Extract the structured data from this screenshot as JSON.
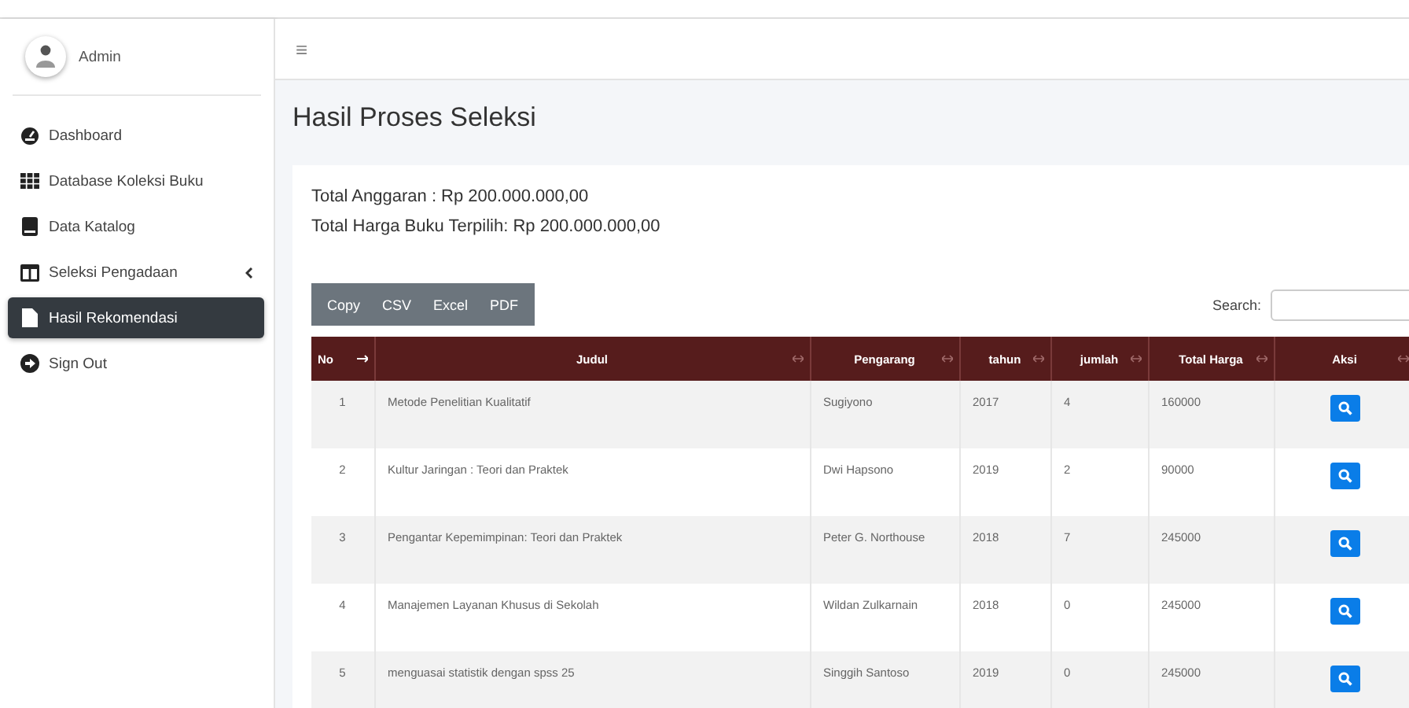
{
  "user": {
    "name": "Admin"
  },
  "sidebar": {
    "items": [
      {
        "label": "Dashboard",
        "selected": false,
        "has_submenu": false
      },
      {
        "label": "Database Koleksi Buku",
        "selected": false,
        "has_submenu": false
      },
      {
        "label": "Data Katalog",
        "selected": false,
        "has_submenu": false
      },
      {
        "label": "Seleksi Pengadaan",
        "selected": false,
        "has_submenu": true
      },
      {
        "label": "Hasil Rekomendasi",
        "selected": true,
        "has_submenu": false
      },
      {
        "label": "Sign Out",
        "selected": false,
        "has_submenu": false
      }
    ]
  },
  "topbar": {
    "menu_glyph": "≡"
  },
  "page": {
    "title": "Hasil Proses Seleksi"
  },
  "summary": [
    "Total Anggaran : Rp 200.000.000,00",
    "Total Harga Buku Terpilih: Rp 200.000.000,00"
  ],
  "export_buttons": [
    "Copy",
    "CSV",
    "Excel",
    "PDF"
  ],
  "search": {
    "label": "Search:"
  },
  "table": {
    "columns": [
      {
        "label": "No",
        "sorted": true
      },
      {
        "label": "Judul",
        "sorted": false
      },
      {
        "label": "Pengarang",
        "sorted": false
      },
      {
        "label": "tahun",
        "sorted": false
      },
      {
        "label": "jumlah",
        "sorted": false
      },
      {
        "label": "Total Harga",
        "sorted": false
      },
      {
        "label": "Aksi",
        "sorted": false
      }
    ],
    "rows": [
      [
        "1",
        "Metode Penelitian Kualitatif",
        "Sugiyono",
        "2017",
        "4",
        "160000"
      ],
      [
        "2",
        "Kultur Jaringan : Teori dan Praktek",
        "Dwi Hapsono",
        "2019",
        "2",
        "90000"
      ],
      [
        "3",
        "Pengantar Kepemimpinan: Teori dan Praktek",
        "Peter G. Northouse",
        "2018",
        "7",
        "245000"
      ],
      [
        "4",
        "Manajemen Layanan Khusus di Sekolah",
        "Wildan Zulkarnain",
        "2018",
        "0",
        "245000"
      ],
      [
        "5",
        "menguasai statistik dengan spss 25",
        "Singgih Santoso",
        "2019",
        "0",
        "245000"
      ]
    ]
  }
}
